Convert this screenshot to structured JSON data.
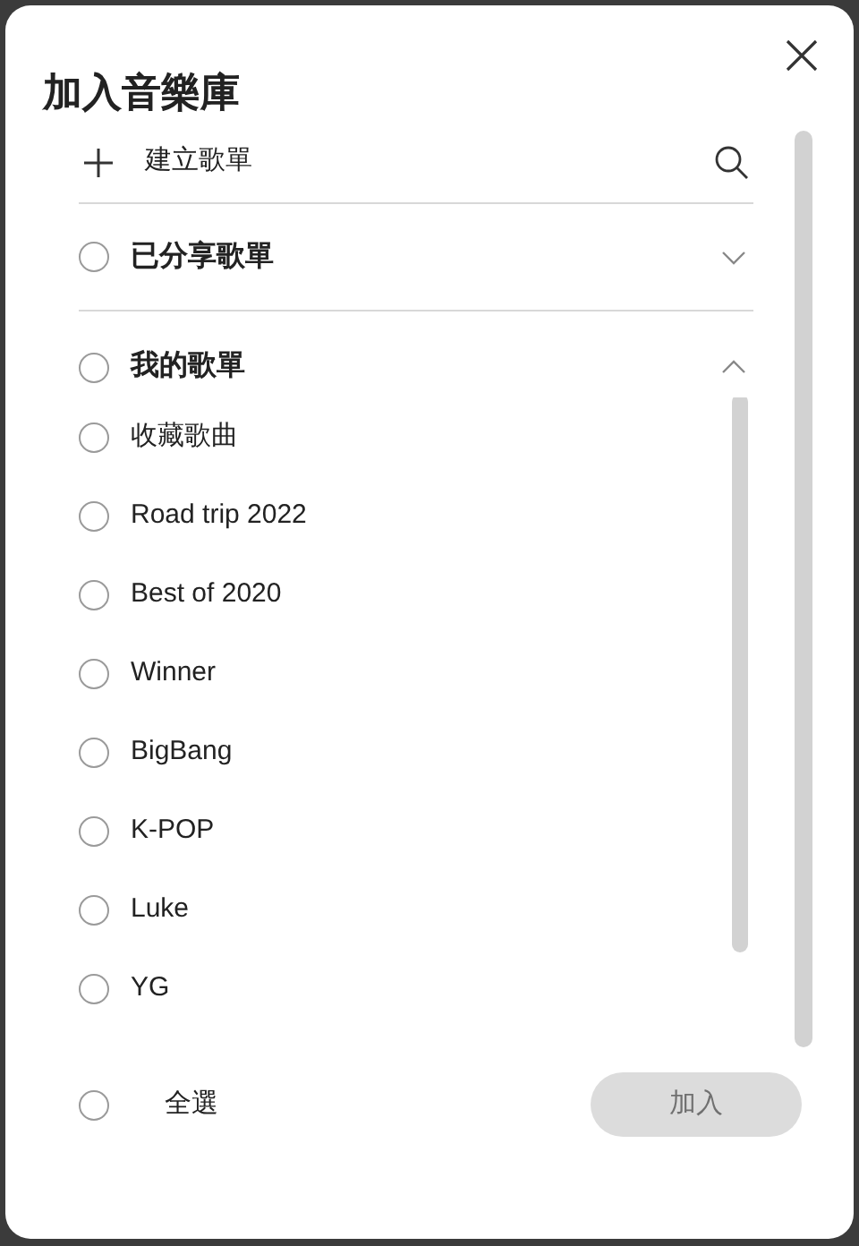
{
  "title": "加入音樂庫",
  "create": {
    "label": "建立歌單"
  },
  "sections": [
    {
      "label": "已分享歌單",
      "checked": false,
      "expanded": false
    },
    {
      "label": "我的歌單",
      "checked": false,
      "expanded": true,
      "items": [
        {
          "label": "收藏歌曲",
          "checked": false
        },
        {
          "label": "Road trip 2022",
          "checked": false
        },
        {
          "label": "Best of 2020",
          "checked": false
        },
        {
          "label": "Winner",
          "checked": false
        },
        {
          "label": "BigBang",
          "checked": false
        },
        {
          "label": "K-POP",
          "checked": false
        },
        {
          "label": "Luke",
          "checked": false
        },
        {
          "label": "YG",
          "checked": false
        }
      ]
    }
  ],
  "footer": {
    "select_all": {
      "label": "全選",
      "checked": false
    },
    "add_button": {
      "label": "加入",
      "disabled": true
    }
  }
}
